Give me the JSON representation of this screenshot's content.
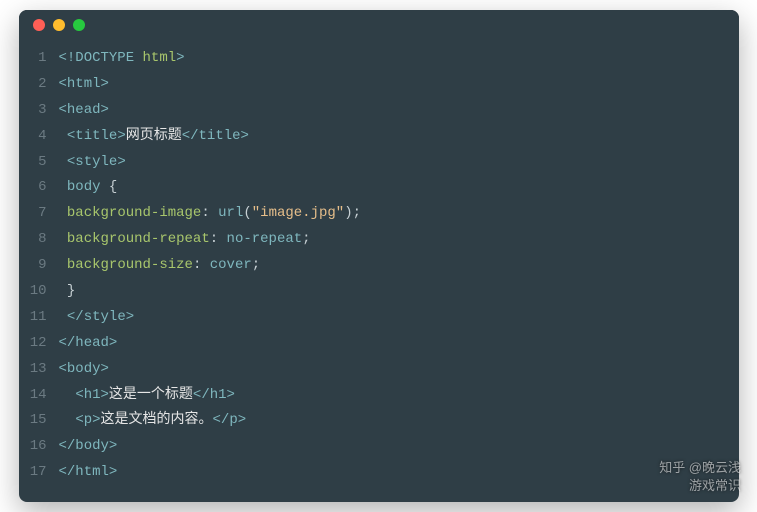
{
  "window": {
    "dots": [
      "red",
      "yellow",
      "green"
    ]
  },
  "code": {
    "lines": [
      {
        "n": "1",
        "segs": [
          {
            "c": "tag",
            "t": "<!DOCTYPE "
          },
          {
            "c": "attr",
            "t": "html"
          },
          {
            "c": "tag",
            "t": ">"
          }
        ]
      },
      {
        "n": "2",
        "segs": [
          {
            "c": "tag",
            "t": "<html>"
          }
        ]
      },
      {
        "n": "3",
        "segs": [
          {
            "c": "tag",
            "t": "<head>"
          }
        ]
      },
      {
        "n": "4",
        "segs": [
          {
            "c": "punct",
            "t": " "
          },
          {
            "c": "tag",
            "t": "<title>"
          },
          {
            "c": "text",
            "t": "网页标题"
          },
          {
            "c": "tag",
            "t": "</title>"
          }
        ]
      },
      {
        "n": "5",
        "segs": [
          {
            "c": "punct",
            "t": " "
          },
          {
            "c": "tag",
            "t": "<style>"
          }
        ]
      },
      {
        "n": "6",
        "segs": [
          {
            "c": "punct",
            "t": " "
          },
          {
            "c": "val",
            "t": "body"
          },
          {
            "c": "punct",
            "t": " {"
          }
        ]
      },
      {
        "n": "7",
        "segs": [
          {
            "c": "punct",
            "t": " "
          },
          {
            "c": "prop",
            "t": "background-image"
          },
          {
            "c": "punct",
            "t": ": "
          },
          {
            "c": "val",
            "t": "url"
          },
          {
            "c": "punct",
            "t": "("
          },
          {
            "c": "str",
            "t": "\"image.jpg\""
          },
          {
            "c": "punct",
            "t": ");"
          }
        ]
      },
      {
        "n": "8",
        "segs": [
          {
            "c": "punct",
            "t": " "
          },
          {
            "c": "prop",
            "t": "background-repeat"
          },
          {
            "c": "punct",
            "t": ": "
          },
          {
            "c": "val",
            "t": "no-repeat"
          },
          {
            "c": "punct",
            "t": ";"
          }
        ]
      },
      {
        "n": "9",
        "segs": [
          {
            "c": "punct",
            "t": " "
          },
          {
            "c": "prop",
            "t": "background-size"
          },
          {
            "c": "punct",
            "t": ": "
          },
          {
            "c": "val",
            "t": "cover"
          },
          {
            "c": "punct",
            "t": ";"
          }
        ]
      },
      {
        "n": "10",
        "segs": [
          {
            "c": "punct",
            "t": " }"
          }
        ]
      },
      {
        "n": "11",
        "segs": [
          {
            "c": "punct",
            "t": " "
          },
          {
            "c": "tag",
            "t": "</style>"
          }
        ]
      },
      {
        "n": "12",
        "segs": [
          {
            "c": "tag",
            "t": "</head>"
          }
        ]
      },
      {
        "n": "13",
        "segs": [
          {
            "c": "tag",
            "t": "<body>"
          }
        ]
      },
      {
        "n": "14",
        "segs": [
          {
            "c": "punct",
            "t": "  "
          },
          {
            "c": "tag",
            "t": "<h1>"
          },
          {
            "c": "text",
            "t": "这是一个标题"
          },
          {
            "c": "tag",
            "t": "</h1>"
          }
        ]
      },
      {
        "n": "15",
        "segs": [
          {
            "c": "punct",
            "t": "  "
          },
          {
            "c": "tag",
            "t": "<p>"
          },
          {
            "c": "text",
            "t": "这是文档的内容。"
          },
          {
            "c": "tag",
            "t": "</p>"
          }
        ]
      },
      {
        "n": "16",
        "segs": [
          {
            "c": "tag",
            "t": "</body>"
          }
        ]
      },
      {
        "n": "17",
        "segs": [
          {
            "c": "tag",
            "t": "</html>"
          }
        ]
      }
    ]
  },
  "watermark": {
    "line1": "知乎 @晚云浅",
    "line2": "游戏常识"
  }
}
